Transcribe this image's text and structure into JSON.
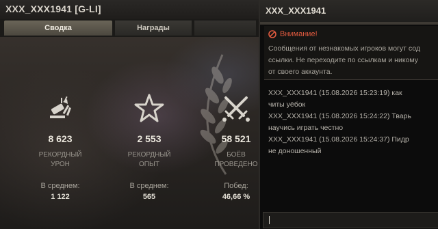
{
  "left_window": {
    "title": "XXX_XXX1941 [G-LI]",
    "tabs": [
      {
        "label": "Сводка",
        "active": true
      },
      {
        "label": "Награды",
        "active": false
      }
    ]
  },
  "stats": [
    {
      "icon": "damage-shell-icon",
      "value": "8 623",
      "label": "РЕКОРДНЫЙ\nУРОН",
      "avg_label": "В среднем:",
      "avg_value": "1 122"
    },
    {
      "icon": "star-icon",
      "value": "2 553",
      "label": "РЕКОРДНЫЙ\nОПЫТ",
      "avg_label": "В среднем:",
      "avg_value": "565"
    },
    {
      "icon": "crossed-swords-icon",
      "value": "58 521",
      "label": "БОЁВ\nПРОВЕДЕНО",
      "avg_label": "Побед:",
      "avg_value": "46,66 %"
    }
  ],
  "chat": {
    "title": "XXX_XXX1941",
    "warning_title": "Внимание!",
    "warning_lines": [
      "Сообщения от незнакомых игроков могут сод",
      "ссылки. Не переходите по ссылкам и никому",
      "от своего аккаунта."
    ],
    "messages": [
      {
        "text_line1": "XXX_XXX1941 (15.08.2026 15:23:19) как",
        "text_line2": "читы уёбок"
      },
      {
        "text_line1": "XXX_XXX1941 (15.08.2026 15:24:22) Тварь",
        "text_line2": "научись играть честно"
      },
      {
        "text_line1": "XXX_XXX1941 (15.08.2026 15:24:37) Пидр",
        "text_line2": "не доношенный"
      }
    ],
    "input_value": ""
  },
  "colors": {
    "warning": "#e05a3f",
    "active_tab": "#5a564b"
  }
}
